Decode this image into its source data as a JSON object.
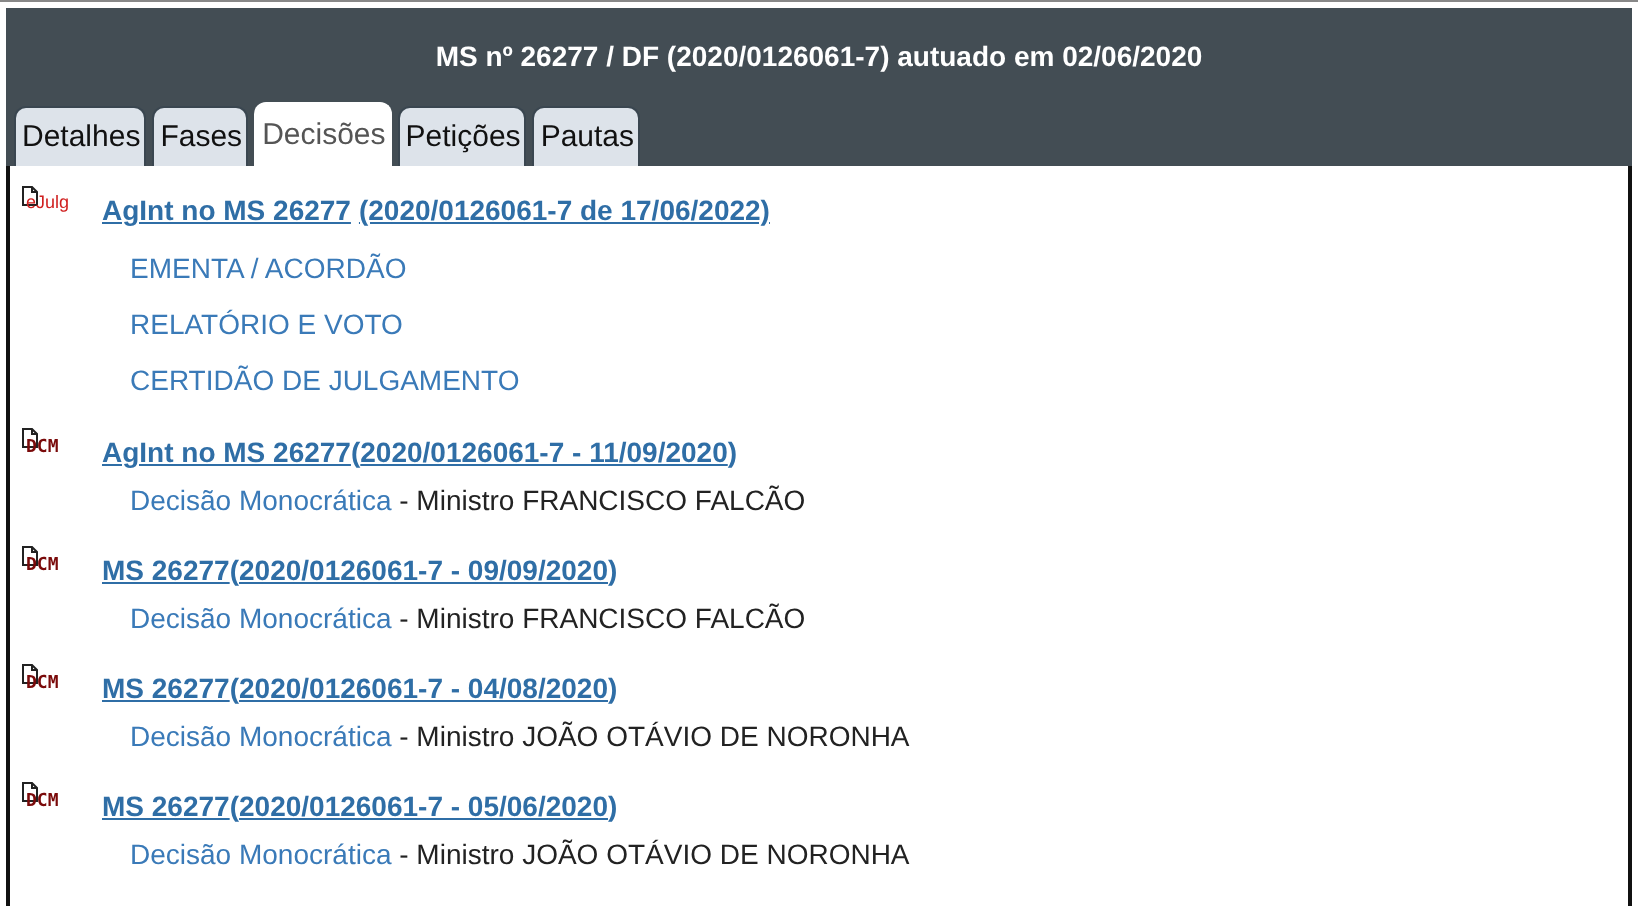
{
  "header": {
    "title": "MS nº 26277 / DF (2020/0126061-7) autuado em 02/06/2020"
  },
  "tabs": [
    {
      "label": "Detalhes",
      "selected": false
    },
    {
      "label": "Fases",
      "selected": false
    },
    {
      "label": "Decisões",
      "selected": true
    },
    {
      "label": "Petições",
      "selected": false
    },
    {
      "label": "Pautas",
      "selected": false
    }
  ],
  "entries": [
    {
      "kind": "ejulg",
      "badge": "eJulg",
      "name": "AgInt no MS 26277",
      "ref": "(2020/0126061-7 de 17/06/2022)",
      "sublinks": [
        "EMENTA / ACORDÃO",
        "RELATÓRIO E VOTO",
        "CERTIDÃO DE JULGAMENTO"
      ]
    },
    {
      "kind": "dcm",
      "badge": "DCM",
      "name": "AgInt no MS 26277",
      "ref_open": "(",
      "ref": "2020/0126061-7 - 11/09/2020",
      "ref_close": ")",
      "detail": {
        "link": "Decisão Monocrática",
        "text": " - Ministro FRANCISCO FALCÃO"
      }
    },
    {
      "kind": "dcm",
      "badge": "DCM",
      "name": "MS 26277",
      "ref_open": "(",
      "ref": "2020/0126061-7 - 09/09/2020",
      "ref_close": ")",
      "detail": {
        "link": "Decisão Monocrática",
        "text": " - Ministro FRANCISCO FALCÃO"
      }
    },
    {
      "kind": "dcm",
      "badge": "DCM",
      "name": "MS 26277",
      "ref_open": "(",
      "ref": "2020/0126061-7 - 04/08/2020",
      "ref_close": ")",
      "detail": {
        "link": "Decisão Monocrática",
        "text": " - Ministro JOÃO OTÁVIO DE NORONHA"
      }
    },
    {
      "kind": "dcm",
      "badge": "DCM",
      "name": "MS 26277",
      "ref_open": "(",
      "ref": "2020/0126061-7 - 05/06/2020",
      "ref_close": ")",
      "detail": {
        "link": "Decisão Monocrática",
        "text": " - Ministro JOÃO OTÁVIO DE NORONHA"
      }
    }
  ]
}
